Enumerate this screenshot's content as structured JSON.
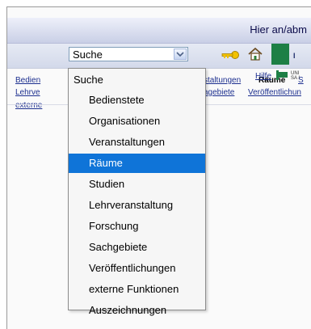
{
  "header": {
    "login_text": "Hier an/abm"
  },
  "toolbar": {
    "select_value": "Suche"
  },
  "nav": {
    "row1": {
      "bedienstete": "Bedien",
      "veranstaltungen": "staltungen",
      "raeume": "Räume",
      "s": "S"
    },
    "row2": {
      "lehrve": "Lehrve",
      "sachgebiete": "agebiete",
      "veroeffentlichungen": "Veröffentlichun"
    },
    "row3": {
      "externe": "externe"
    },
    "left_fragment": "l",
    "hilfe": "Hilfe"
  },
  "logo": {
    "line1": "UNI",
    "line2": "SA I"
  },
  "dropdown": {
    "options": [
      "Suche",
      "Bedienstete",
      "Organisationen",
      "Veranstaltungen",
      "Räume",
      "Studien",
      "Lehrveranstaltung",
      "Forschung",
      "Sachgebiete",
      "Veröffentlichungen",
      "externe Funktionen",
      "Auszeichnungen"
    ],
    "selected": "Räume"
  },
  "colors": {
    "selection": "#0f74d8",
    "link": "#1c2f8f",
    "logo_green": "#1d7f45"
  }
}
